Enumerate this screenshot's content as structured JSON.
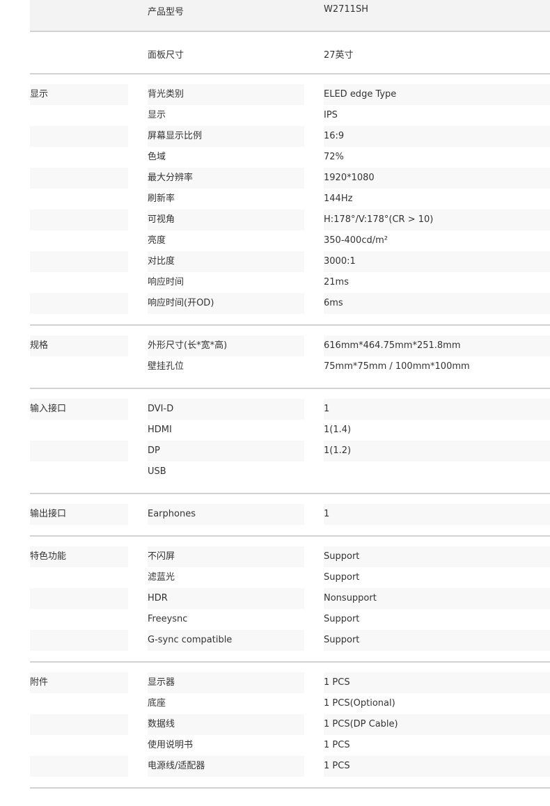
{
  "header_rows": [
    {
      "label": "产品型号",
      "value": "W2711SH"
    },
    {
      "label": "面板尺寸",
      "value": "27英寸"
    }
  ],
  "sections": [
    {
      "category": "显示",
      "rows": [
        {
          "label": "背光类别",
          "value": "ELED edge Type"
        },
        {
          "label": "显示",
          "value": "IPS"
        },
        {
          "label": "屏幕显示比例",
          "value": "16:9"
        },
        {
          "label": "色域",
          "value": "72%"
        },
        {
          "label": "最大分辨率",
          "value": "1920*1080"
        },
        {
          "label": "刷新率",
          "value": "144Hz"
        },
        {
          "label": "可视角",
          "value": "H:178°/V:178°(CR > 10)"
        },
        {
          "label": "亮度",
          "value": "350-400cd/m²"
        },
        {
          "label": "对比度",
          "value": "3000:1"
        },
        {
          "label": "响应时间",
          "value": "21ms"
        },
        {
          "label": "响应时间(开OD)",
          "value": "6ms"
        }
      ]
    },
    {
      "category": "规格",
      "rows": [
        {
          "label": "外形尺寸(长*宽*高)",
          "value": "616mm*464.75mm*251.8mm"
        },
        {
          "label": "壁挂孔位",
          "value": "75mm*75mm / 100mm*100mm"
        }
      ]
    },
    {
      "category": "输入接口",
      "rows": [
        {
          "label": "DVI-D",
          "value": "1"
        },
        {
          "label": "HDMI",
          "value": "1(1.4)"
        },
        {
          "label": "DP",
          "value": "1(1.2)"
        },
        {
          "label": "USB",
          "value": ""
        }
      ]
    },
    {
      "category": "输出接口",
      "rows": [
        {
          "label": "Earphones",
          "value": "1"
        }
      ]
    },
    {
      "category": "特色功能",
      "rows": [
        {
          "label": "不闪屏",
          "value": "Support"
        },
        {
          "label": "滤蓝光",
          "value": "Support"
        },
        {
          "label": "HDR",
          "value": "Nonsupport"
        },
        {
          "label": "Freeysnc",
          "value": "Support"
        },
        {
          "label": "G-sync compatible",
          "value": "Support"
        }
      ]
    },
    {
      "category": "附件",
      "rows": [
        {
          "label": "显示器",
          "value": "1 PCS"
        },
        {
          "label": "底座",
          "value": "1 PCS(Optional)"
        },
        {
          "label": "数据线",
          "value": "1 PCS(DP Cable)"
        },
        {
          "label": "使用说明书",
          "value": "1 PCS"
        },
        {
          "label": "电源线/适配器",
          "value": "1 PCS"
        }
      ]
    }
  ]
}
